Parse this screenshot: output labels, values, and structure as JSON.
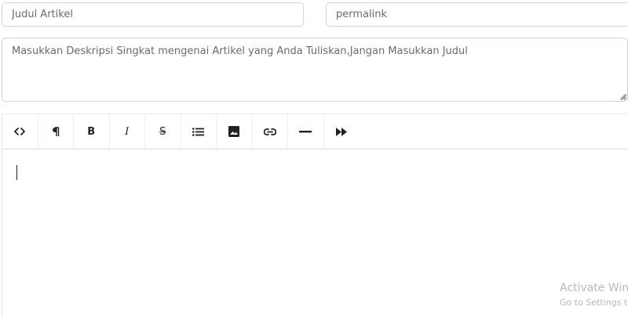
{
  "form": {
    "title_placeholder": "Judul Artikel",
    "permalink_placeholder": "permalink",
    "description_placeholder": "Masukkan Deskripsi Singkat mengenai Artikel yang Anda Tuliskan,Jangan Masukkan Judul"
  },
  "toolbar": {
    "buttons": [
      {
        "name": "code-view",
        "icon": "code-icon"
      },
      {
        "name": "paragraph",
        "icon": "pilcrow-icon"
      },
      {
        "name": "bold",
        "icon": "bold-icon",
        "label": "B"
      },
      {
        "name": "italic",
        "icon": "italic-icon",
        "label": "I"
      },
      {
        "name": "strikethrough",
        "icon": "strikethrough-icon",
        "label": "S"
      },
      {
        "name": "unordered-list",
        "icon": "list-icon"
      },
      {
        "name": "insert-image",
        "icon": "image-icon"
      },
      {
        "name": "insert-link",
        "icon": "link-icon"
      },
      {
        "name": "horizontal-rule",
        "icon": "horizontal-rule-icon"
      },
      {
        "name": "read-more",
        "icon": "fast-forward-icon"
      }
    ]
  },
  "watermark": {
    "title": "Activate Win",
    "subtitle": "Go to Settings to"
  }
}
